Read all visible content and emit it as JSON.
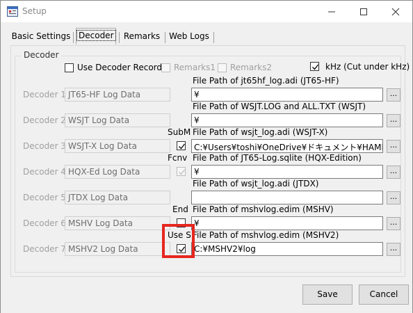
{
  "window": {
    "title": "Setup"
  },
  "tabs": [
    "Basic Settings",
    "Decoder",
    "Remarks",
    "Web Logs"
  ],
  "group": {
    "legend": "Decoder",
    "decoder_record_label": "Use Decoder Record",
    "remarks1_label": "Remarks1",
    "remarks2_label": "Remarks2",
    "khz_label": "kHz (Cut under kHz)",
    "rows": [
      {
        "label": "Decoder 1",
        "name": "JT65-HF Log Data",
        "prefix": "",
        "path_label": "File Path of jt65hf_log.adi (JT65-HF)",
        "path": "¥"
      },
      {
        "label": "Decoder 2",
        "name": "WSJT Log Data",
        "prefix": "",
        "path_label": "File Path of WSJT.LOG and ALL.TXT (WSJT)",
        "path": "¥"
      },
      {
        "label": "Decoder 3",
        "name": "WSJT-X Log Data",
        "prefix": "SubM",
        "path_label": "File Path of wsjt_log.adi (WSJT-X)",
        "path": "C:¥Users¥toshi¥OneDrive¥ドキュメント¥HAMLOG"
      },
      {
        "label": "Decoder 4",
        "name": "HQX-Ed Log Data",
        "prefix": "Fcnv",
        "path_label": "File Path of JT65-Log.sqlite (HQX-Edition)",
        "path": "¥"
      },
      {
        "label": "Decoder 5",
        "name": "JTDX Log Data",
        "prefix": "",
        "path_label": "File Path of wsjt_log.adi (JTDX)",
        "path": ""
      },
      {
        "label": "Decoder 6",
        "name": "MSHV Log Data",
        "prefix": "End",
        "path_label": "File Path of mshvlog.edim (MSHV)",
        "path": "¥"
      },
      {
        "label": "Decoder 7",
        "name": "MSHV2 Log Data",
        "prefix": "Use S",
        "path_label": "File Path of mshvlog.edim (MSHV2)",
        "path": "C:¥MSHV2¥log"
      }
    ],
    "browse_label": "..."
  },
  "buttons": {
    "save": "Save",
    "cancel": "Cancel"
  },
  "colors": {
    "highlight": "#e6261f"
  }
}
